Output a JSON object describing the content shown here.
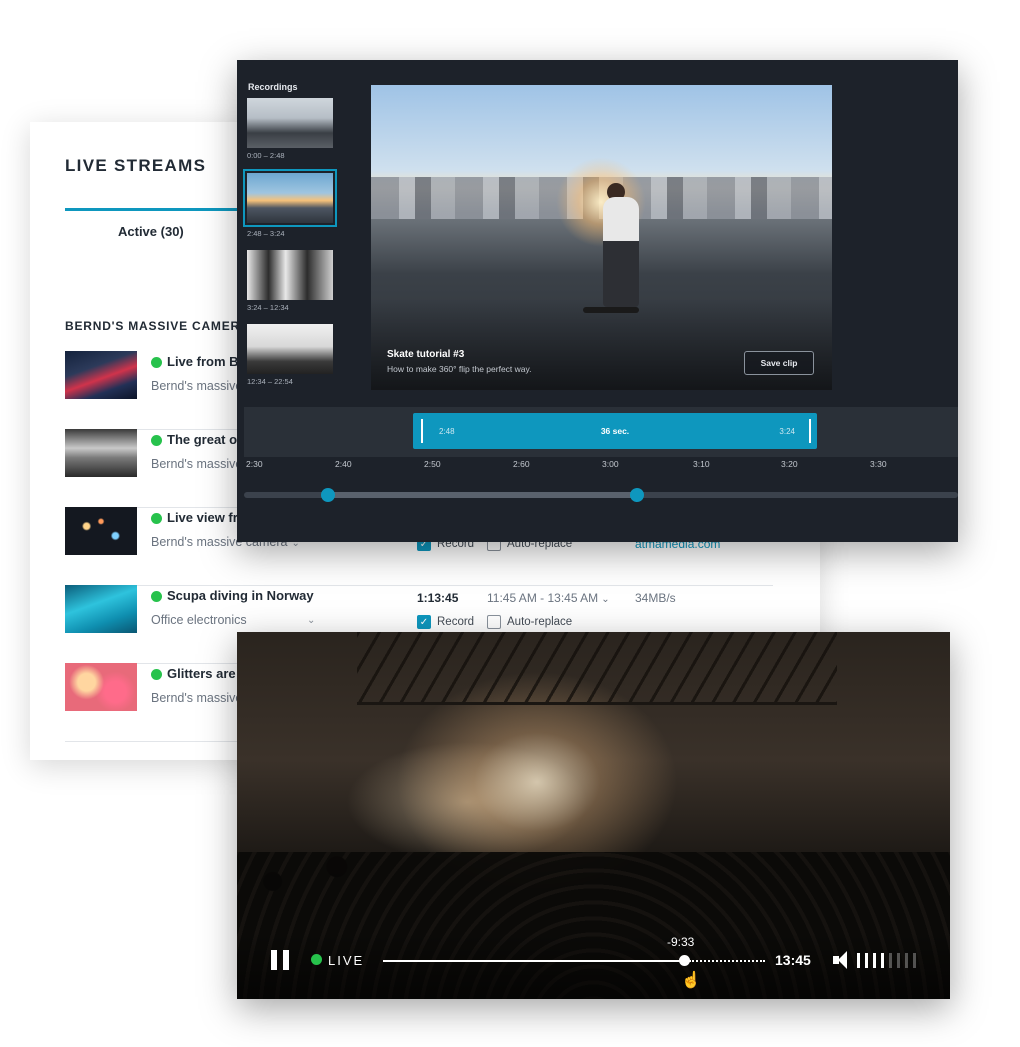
{
  "streams_card": {
    "title": "LIVE STREAMS",
    "active_tab": "Active (30)",
    "section_heading": "BERND'S MASSIVE CAMERA",
    "rows": [
      {
        "title": "Live from Berlin",
        "source": "Bernd's massive camera",
        "duration": "",
        "time": "",
        "rate": "",
        "link": ""
      },
      {
        "title": "The great ocean",
        "source": "Bernd's massive camera",
        "duration": "",
        "time": "",
        "rate": "",
        "link": ""
      },
      {
        "title": "Live view from the city",
        "source": "Bernd's massive camera",
        "duration": "",
        "time": "",
        "rate": "",
        "link": "atmamedia.com",
        "record": "Record",
        "auto_replace": "Auto-replace"
      },
      {
        "title": "Scupa diving in Norway",
        "source": "Office electronics",
        "duration": "1:13:45",
        "time": "11:45 AM - 13:45 AM",
        "rate": "34MB/s",
        "link": "",
        "record": "Record",
        "auto_replace": "Auto-replace"
      },
      {
        "title": "Glitters are everywhere",
        "source": "Bernd's massive camera",
        "duration": "",
        "time": "",
        "rate": "",
        "link": ""
      }
    ]
  },
  "recordings": {
    "label": "Recordings",
    "items": [
      {
        "time": "0:00 – 2:48"
      },
      {
        "time": "2:48 – 3:24"
      },
      {
        "time": "3:24 – 12:34"
      },
      {
        "time": "12:34 – 22:54"
      }
    ],
    "video": {
      "title": "Skate tutorial #3",
      "subtitle": "How to make 360° flip the perfect way.",
      "save_label": "Save clip"
    },
    "clip": {
      "start": "2:48",
      "length": "36 sec.",
      "end": "3:24"
    },
    "ticks": [
      "2:30",
      "2:40",
      "2:50",
      "2:60",
      "3:00",
      "3:10",
      "3:20",
      "3:30"
    ]
  },
  "player": {
    "live_label": "LIVE",
    "remaining": "-9:33",
    "total": "13:45",
    "progress_fraction": 0.8,
    "volume_level": 4,
    "volume_steps": 8
  },
  "icons": {
    "pause": "pause-icon",
    "volume": "volume-icon",
    "cursor": "hand-pointer-icon",
    "chevron": "chevron-down-icon"
  },
  "colors": {
    "accent": "#0e97be",
    "live": "#27c24c",
    "dark_panel": "#1d222a"
  }
}
